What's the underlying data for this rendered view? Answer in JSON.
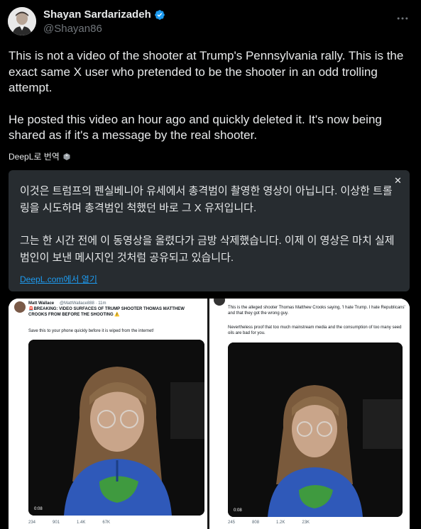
{
  "author": {
    "name": "Shayan Sardarizadeh",
    "handle": "@Shayan86",
    "verified": true
  },
  "tweet": {
    "paragraph1": "This is not a video of the shooter at Trump's Pennsylvania rally. This is the exact same X user who pretended to be the shooter in an odd trolling attempt.",
    "paragraph2": "He posted this video an hour ago and quickly deleted it. It's now being shared as if it's a message by the real shooter."
  },
  "translate_label": "DeepL로 번역",
  "translation": {
    "paragraph1": "이것은 트럼프의 펜실베니아 유세에서 총격범이 촬영한 영상이 아닙니다. 이상한 트롤링을 시도하며 총격범인 척했던 바로 그 X 유저입니다.",
    "paragraph2": "그는 한 시간 전에 이 동영상을 올렸다가 금방 삭제했습니다. 이제 이 영상은 마치 실제 범인이 보낸 메시지인 것처럼 공유되고 있습니다.",
    "link": "DeepL.com에서 열기"
  },
  "media": {
    "left": {
      "author": "Matt Wallace",
      "handle": "@MattWallace888 · 11m",
      "headline": "🚨BREAKING: VIDEO SURFACES OF TRUMP SHOOTER THOMAS MATTHEW CROOKS FROM BEFORE THE SHOOTING ⚠️",
      "subtext": "Save this to your phone quickly before it is wiped from the internet!",
      "timestamp": "0:08",
      "stats": [
        "234",
        "901",
        "1.4K",
        "67K"
      ]
    },
    "right": {
      "headline": "This is the alleged shooter Thomas Matthew Crooks saying, 'I hate Trump. I hate Republicans' and that they got the wrong guy.",
      "subtext": "Nevertheless proof that too much mainstream media and the consumption of too many seed oils are bad for you.",
      "timestamp": "0:08",
      "stats": [
        "245",
        "808",
        "1.2K",
        "23K"
      ]
    }
  },
  "colors": {
    "accent": "#1d9bf0",
    "background": "#000000",
    "translation_bg": "#272c30"
  }
}
